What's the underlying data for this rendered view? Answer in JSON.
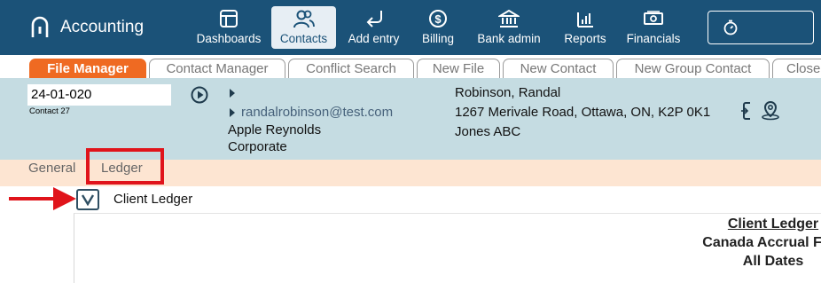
{
  "app": {
    "title": "Accounting"
  },
  "nav": [
    {
      "label": "Dashboards",
      "icon": "dashboard-icon",
      "active": false
    },
    {
      "label": "Contacts",
      "icon": "contacts-icon",
      "active": true
    },
    {
      "label": "Add entry",
      "icon": "add-entry-icon",
      "active": false
    },
    {
      "label": "Billing",
      "icon": "billing-icon",
      "active": false
    },
    {
      "label": "Bank admin",
      "icon": "bank-icon",
      "active": false
    },
    {
      "label": "Reports",
      "icon": "reports-icon",
      "active": false
    },
    {
      "label": "Financials",
      "icon": "financials-icon",
      "active": false
    }
  ],
  "tabs": [
    "File Manager",
    "Contact Manager",
    "Conflict Search",
    "New File",
    "New Contact",
    "New Group Contact",
    "Close"
  ],
  "contact": {
    "file_number": "24-01-020",
    "contact_label": "Contact 27",
    "email": "randalrobinson@test.com",
    "company_line1": "Apple Reynolds",
    "company_line2": "Corporate",
    "client_name": "Robinson, Randal",
    "client_address": "1267 Merivale Road, Ottawa, ON, K2P 0K1",
    "client_firm": "Jones ABC"
  },
  "subtabs": {
    "general": "General",
    "ledger": "Ledger"
  },
  "ledger": {
    "section_title": "Client Ledger",
    "report_title": "Client Ledger",
    "firm": "Canada Accrual Firm",
    "dates": "All Dates"
  },
  "colors": {
    "nav_bg": "#1b5278",
    "tab_active": "#ef6a22",
    "panel_bg": "#c5dce2",
    "subtab_bg": "#fde5d2",
    "annotation": "#e0141b"
  }
}
